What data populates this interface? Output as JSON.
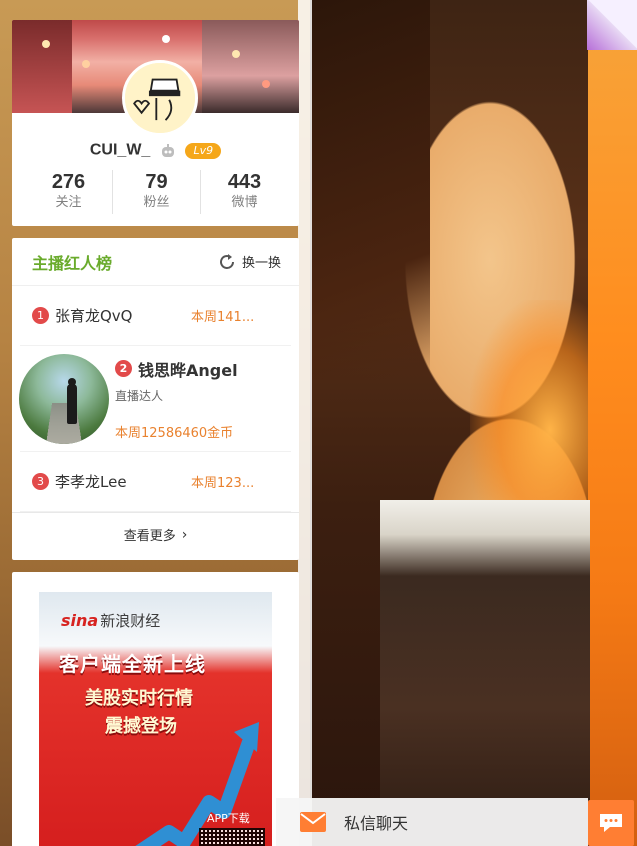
{
  "profile": {
    "username": "CUI_W_",
    "level": "Lv9",
    "stats": [
      {
        "value": "276",
        "label": "关注"
      },
      {
        "value": "79",
        "label": "粉丝"
      },
      {
        "value": "443",
        "label": "微博"
      }
    ]
  },
  "ranking": {
    "title": "主播红人榜",
    "refresh_label": "换一换",
    "items": [
      {
        "rank": "1",
        "name": "张育龙QvQ",
        "week": "本周141..."
      },
      {
        "rank": "2",
        "name": "钱思晔Angel",
        "title": "直播达人",
        "week": "本周12586460金币"
      },
      {
        "rank": "3",
        "name": "李孝龙Lee",
        "week": "本周123..."
      }
    ],
    "see_more": "查看更多"
  },
  "ad": {
    "logo": "sina",
    "brand": "新浪财经",
    "line1": "客户端全新上线",
    "line2": "美股实时行情",
    "line3": "震撼登场",
    "app": "APP下载"
  },
  "message_bar": {
    "label": "私信聊天"
  },
  "colors": {
    "accent_green": "#6aab2c",
    "accent_orange": "#e9822f",
    "rank_badge": "#e24a4a",
    "level_badge": "#f5a71a",
    "chat_button": "#ff7e33"
  }
}
